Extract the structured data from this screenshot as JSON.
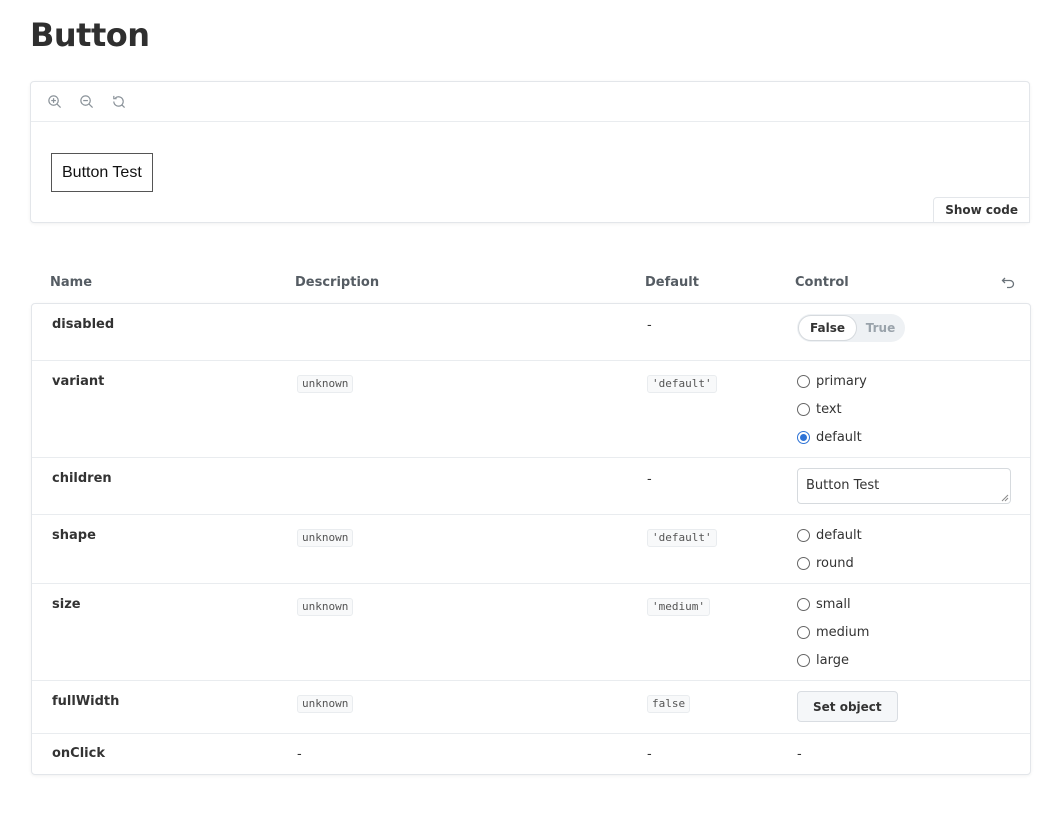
{
  "page": {
    "title": "Button"
  },
  "preview": {
    "toolbar": {
      "zoom_in": "zoom-in-icon",
      "zoom_out": "zoom-out-icon",
      "reset": "zoom-reset-icon"
    },
    "demo_button_label": "Button Test",
    "show_code_label": "Show code"
  },
  "args_table": {
    "headers": {
      "name": "Name",
      "description": "Description",
      "default": "Default",
      "control": "Control"
    },
    "rows": {
      "disabled": {
        "name": "disabled",
        "default": "-",
        "toggle": {
          "on": "False",
          "off": "True"
        }
      },
      "variant": {
        "name": "variant",
        "description": "unknown",
        "default": "'default'",
        "options": [
          "primary",
          "text",
          "default"
        ],
        "selected": "default"
      },
      "children": {
        "name": "children",
        "default": "-",
        "value": "Button Test"
      },
      "shape": {
        "name": "shape",
        "description": "unknown",
        "default": "'default'",
        "options": [
          "default",
          "round"
        ]
      },
      "size": {
        "name": "size",
        "description": "unknown",
        "default": "'medium'",
        "options": [
          "small",
          "medium",
          "large"
        ]
      },
      "fullWidth": {
        "name": "fullWidth",
        "description": "unknown",
        "default": "false",
        "control_label": "Set object"
      },
      "onClick": {
        "name": "onClick",
        "description": "-",
        "default": "-",
        "control": "-"
      }
    }
  },
  "colors": {
    "accent": "#2e73d6",
    "border": "#e3e6ea",
    "muted": "#9aa3ab"
  }
}
